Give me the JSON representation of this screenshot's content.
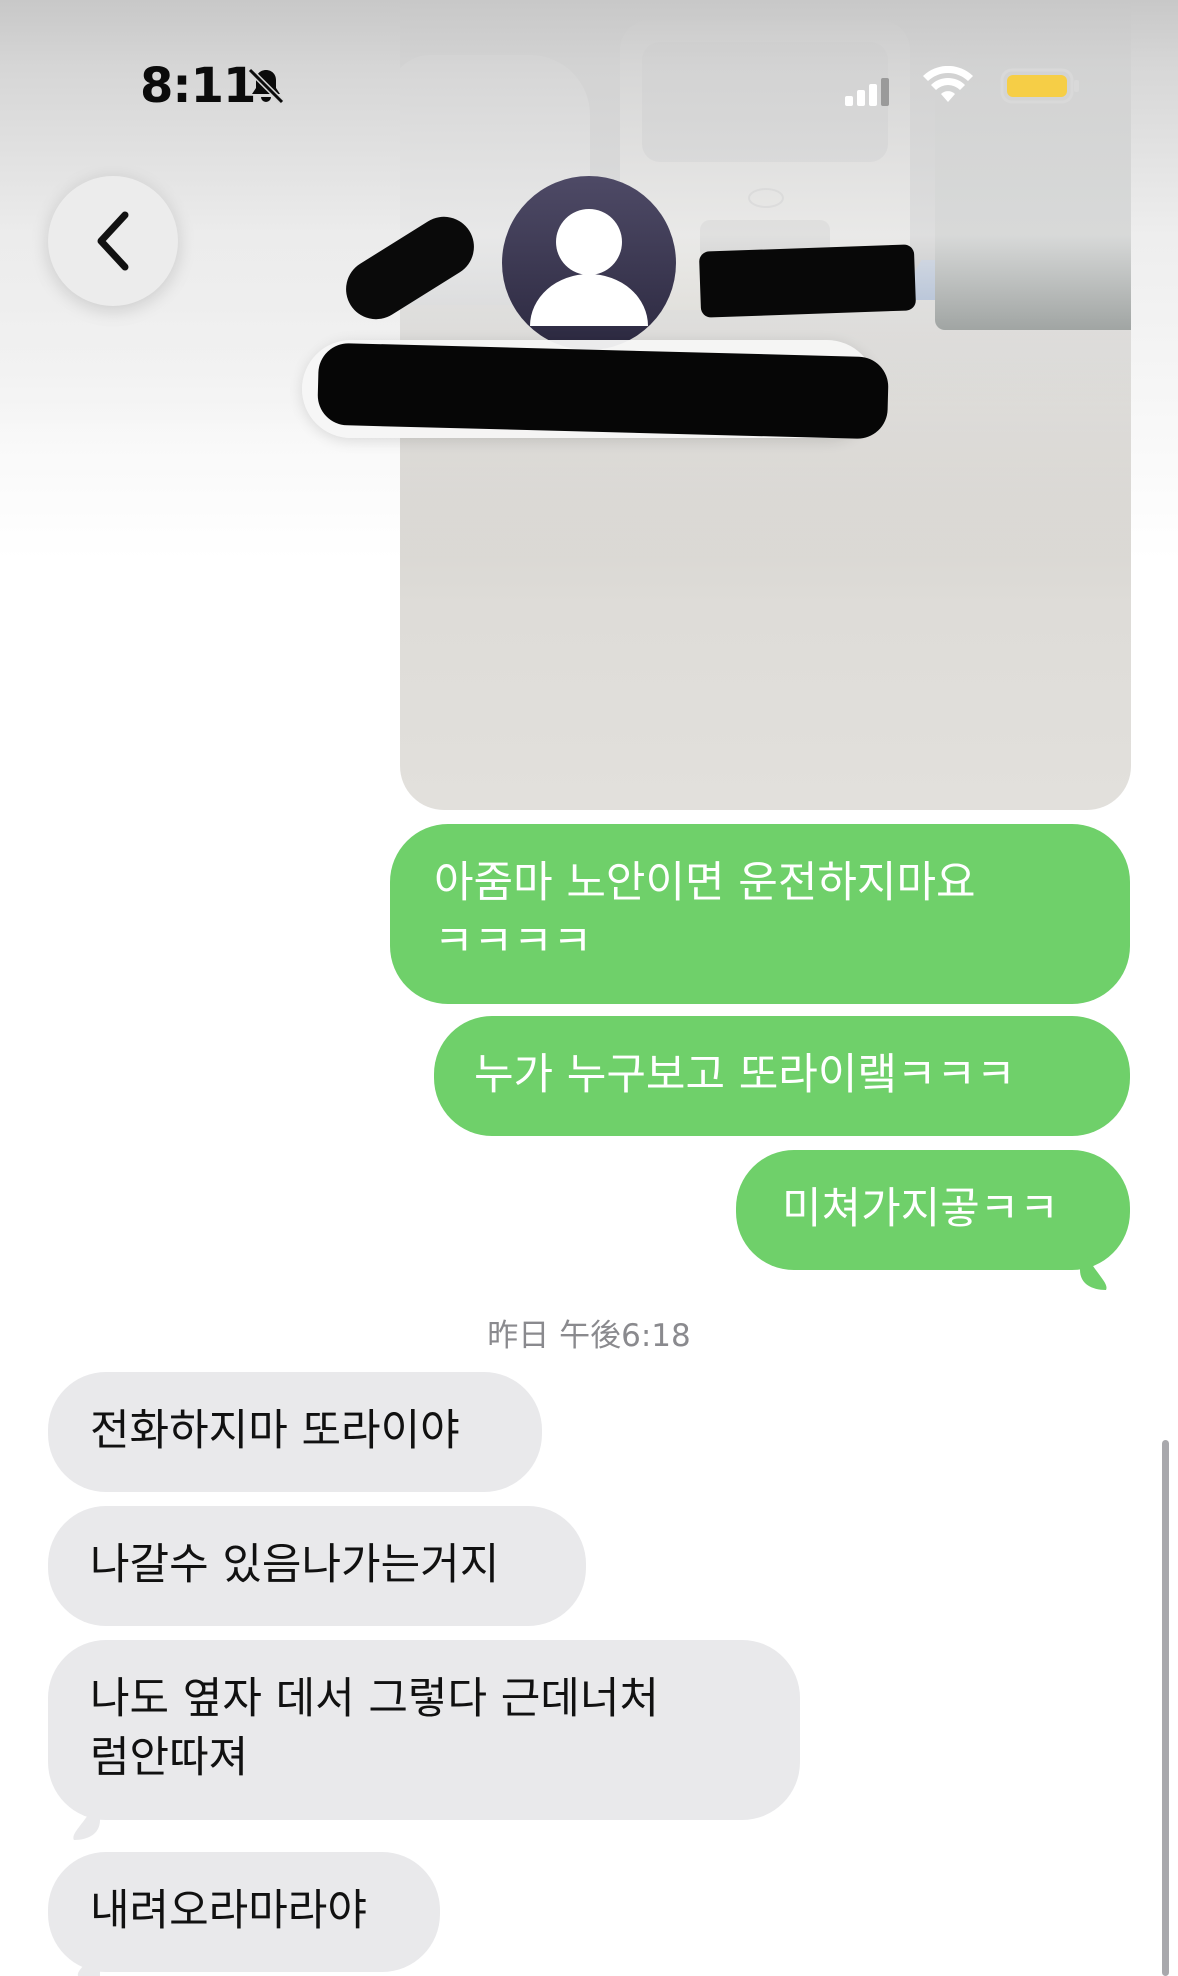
{
  "status_bar": {
    "time": "8:11",
    "silent_icon": "bell-slash-icon",
    "signal_icon": "cellular-signal-icon",
    "wifi_icon": "wifi-icon",
    "battery_icon": "battery-icon",
    "battery_color": "#f6ce46"
  },
  "header": {
    "back_icon": "chevron-left-icon",
    "avatar_icon": "person-silhouette-icon"
  },
  "colors": {
    "outgoing_bubble": "#6fd06a",
    "incoming_bubble": "#e9e9eb",
    "timestamp": "#8a8a8e"
  },
  "messages": [
    {
      "direction": "outgoing",
      "type": "image"
    },
    {
      "direction": "outgoing",
      "text": "아줌마 노안이면 운전하지마요\nㅋㅋㅋㅋ"
    },
    {
      "direction": "outgoing",
      "text": "누가 누구보고 또라이랰ㅋㅋㅋ"
    },
    {
      "direction": "outgoing",
      "text": "미쳐가지곻ㅋㅋ"
    }
  ],
  "timestamp": "昨日 午後6:18",
  "incoming": [
    {
      "text": "전화하지마 또라이야"
    },
    {
      "text": "나갈수 있음나가는거지"
    },
    {
      "text": "나도 옆자 데서 그렇다 근데너처\n럼안따져"
    },
    {
      "text": "내려오라마라야"
    }
  ]
}
